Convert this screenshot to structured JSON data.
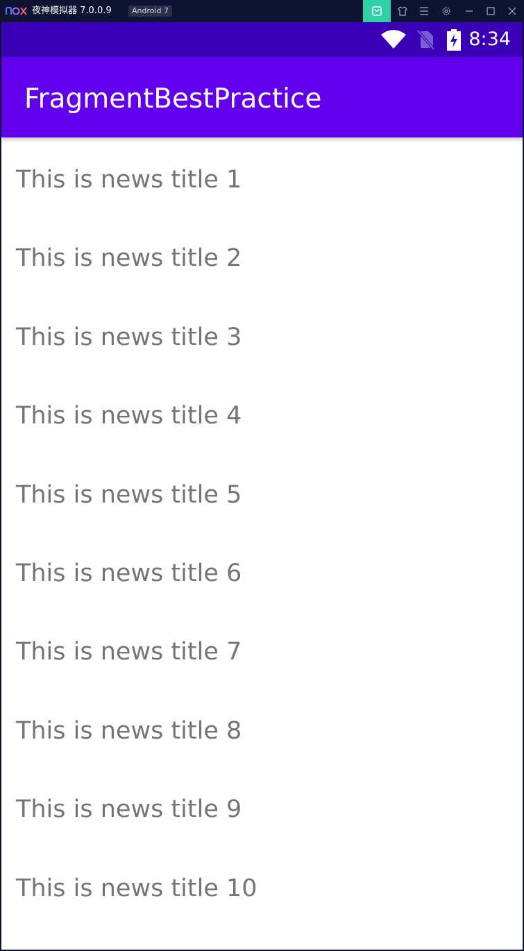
{
  "emulator": {
    "title": "夜神模拟器 7.0.0.9",
    "android_version": "Android 7",
    "logo_text": "nox",
    "titlebar_buttons": [
      "store-icon",
      "skin-icon",
      "menu-icon",
      "settings-icon",
      "minimize-icon",
      "maximize-icon",
      "close-icon"
    ],
    "accent_color": "#2fd1a6"
  },
  "status_bar": {
    "time": "8:34",
    "icons": [
      "wifi-icon",
      "no-sim-icon",
      "battery-charging-icon"
    ],
    "color": "#3a00b5"
  },
  "app_bar": {
    "title": "FragmentBestPractice",
    "color": "#6200ee"
  },
  "news": {
    "items": [
      {
        "title": "This is news title 1"
      },
      {
        "title": "This is news title 2"
      },
      {
        "title": "This is news title 3"
      },
      {
        "title": "This is news title 4"
      },
      {
        "title": "This is news title 5"
      },
      {
        "title": "This is news title 6"
      },
      {
        "title": "This is news title 7"
      },
      {
        "title": "This is news title 8"
      },
      {
        "title": "This is news title 9"
      },
      {
        "title": "This is news title 10"
      }
    ]
  }
}
